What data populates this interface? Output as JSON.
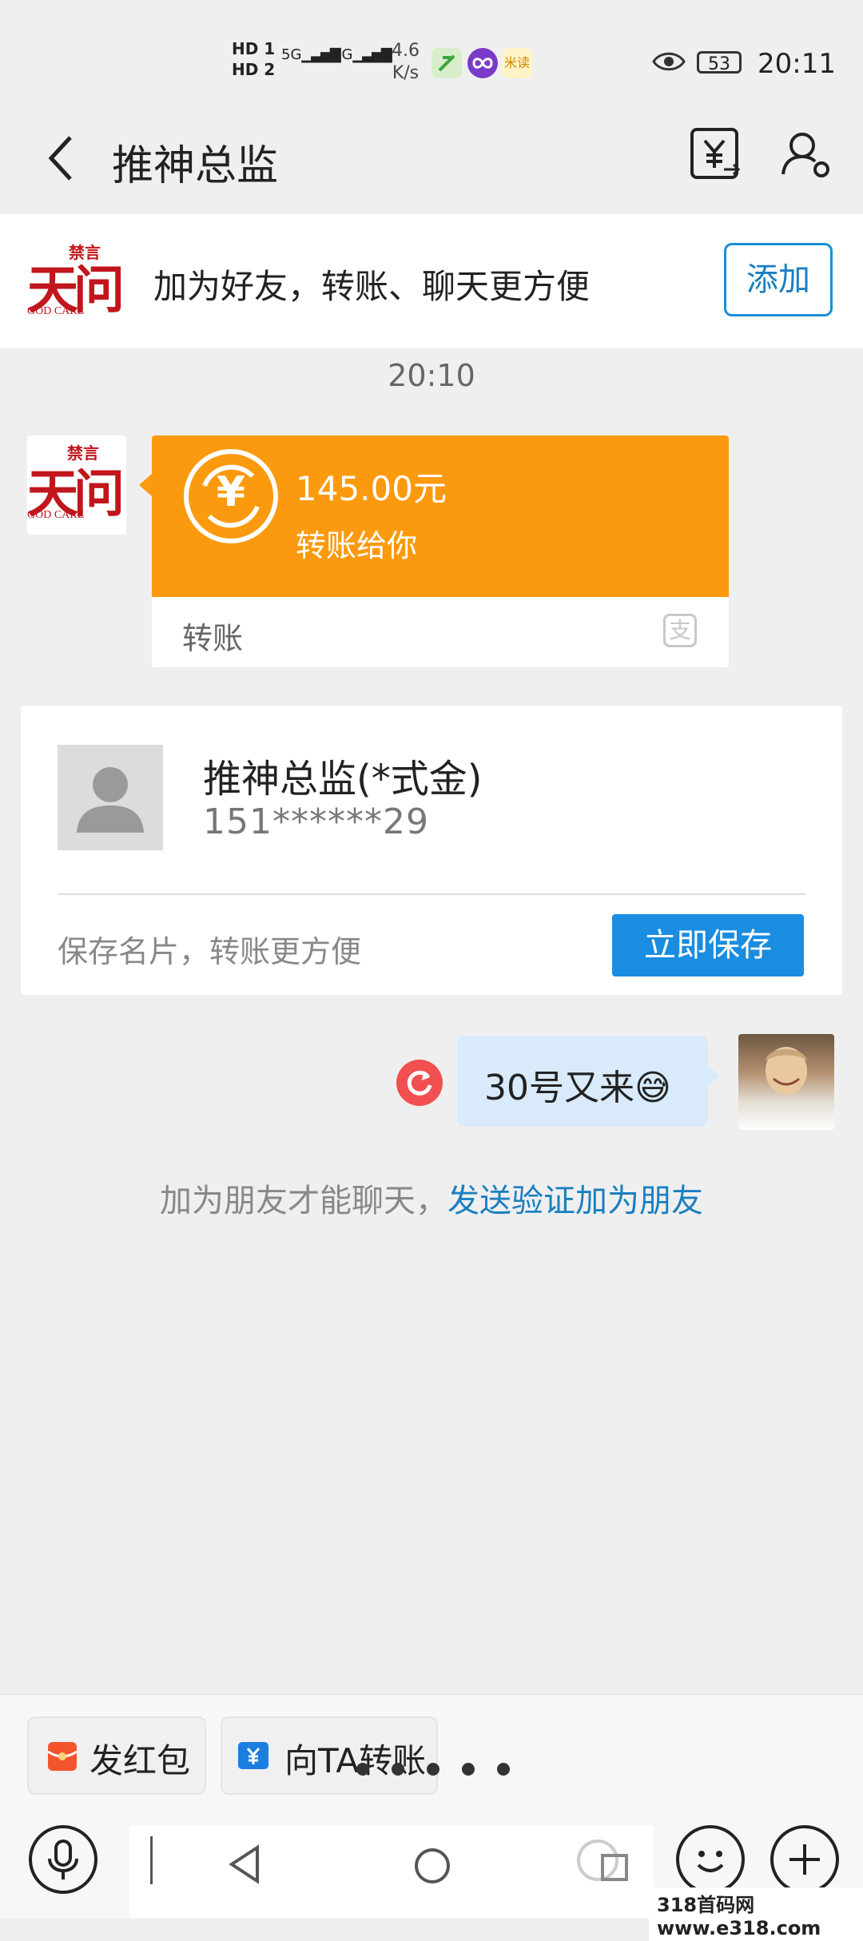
{
  "status_bar": {
    "hd1": "HD 1",
    "hd2": "HD 2",
    "net1": "5G",
    "net2": "4G",
    "speed_value": "4.6",
    "speed_unit": "K/s",
    "battery": "53",
    "time": "20:11",
    "app2_label": "米读"
  },
  "header": {
    "title": "推神总监"
  },
  "banner": {
    "logo_small": "禁言",
    "logo_big": "天问",
    "logo_sub": "GOD CARE",
    "text": "加为好友，转账、聊天更方便",
    "add_label": "添加"
  },
  "chat": {
    "timestamp": "20:10",
    "transfer": {
      "amount": "145.00元",
      "subtitle": "转账给你",
      "label": "转账",
      "currency_symbol": "¥",
      "source_icon": "支"
    },
    "contact_card": {
      "name": "推神总监(*式金)",
      "phone": "151******29",
      "hint": "保存名片，转账更方便",
      "save_label": "立即保存"
    },
    "my_message": {
      "text": "30号又来😅"
    },
    "system_message": {
      "text": "加为朋友才能聊天，",
      "link": "发送验证加为朋友"
    }
  },
  "quick_actions": {
    "red_packet": "发红包",
    "transfer_to": "向TA转账",
    "transfer_icon_symbol": "¥"
  },
  "watermark": "318首码网 www.e318.com",
  "colors": {
    "transfer_orange": "#fb9a0e",
    "link_blue": "#1a7fc0",
    "button_blue": "#1a8de0",
    "bubble_blue": "#d9ebfb"
  }
}
